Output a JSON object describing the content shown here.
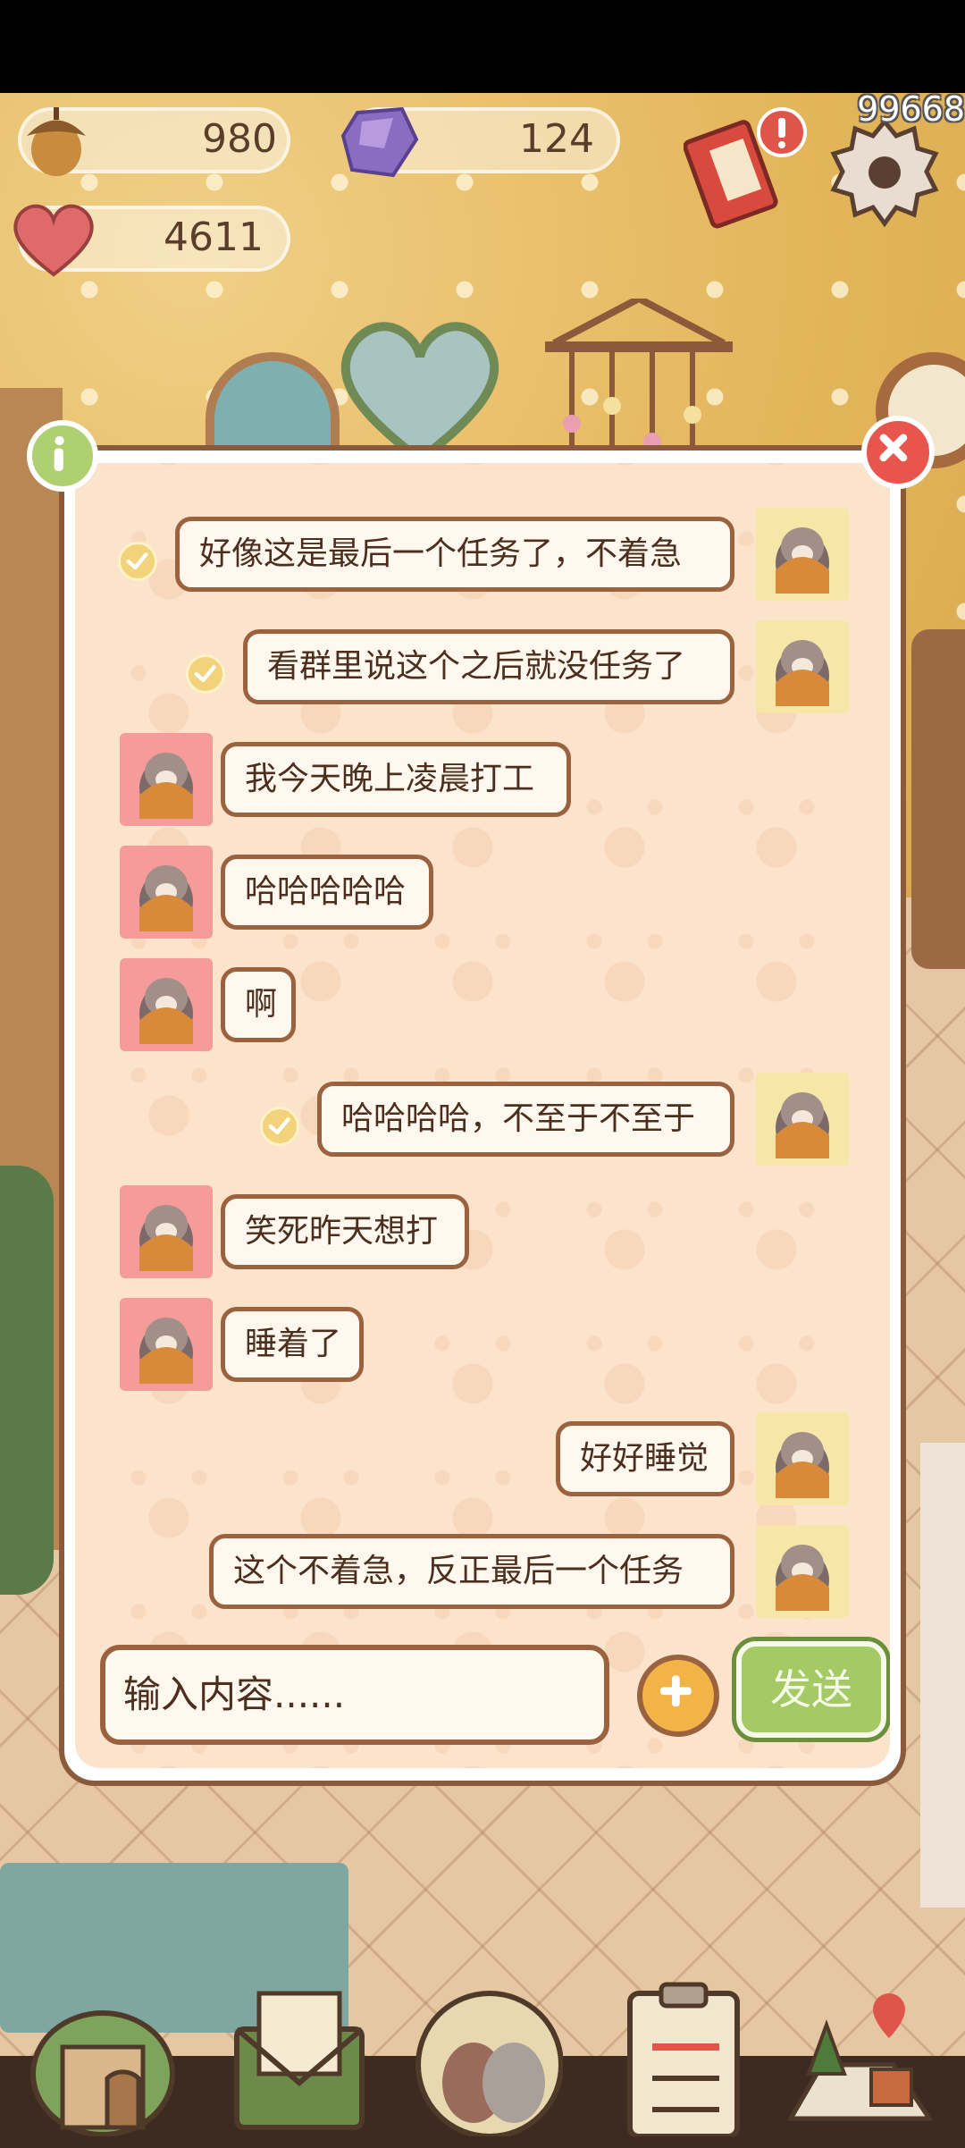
{
  "status_bar": {},
  "hud": {
    "acorns": "980",
    "gems": "124",
    "hearts": "4611",
    "fps_counter": "99668"
  },
  "chat": {
    "messages": [
      {
        "side": "mine",
        "text": "好像这是最后一个任务了，不着急",
        "read": true
      },
      {
        "side": "mine",
        "text": "看群里说这个之后就没任务了",
        "read": true
      },
      {
        "side": "theirs",
        "text": "我今天晚上凌晨打工",
        "read": false
      },
      {
        "side": "theirs",
        "text": "哈哈哈哈哈",
        "read": false
      },
      {
        "side": "theirs",
        "text": "啊",
        "read": false
      },
      {
        "side": "mine",
        "text": "哈哈哈哈，不至于不至于",
        "read": true
      },
      {
        "side": "theirs",
        "text": "笑死昨天想打",
        "read": false
      },
      {
        "side": "theirs",
        "text": "睡着了",
        "read": false
      },
      {
        "side": "mine",
        "text": "好好睡觉",
        "read": false
      },
      {
        "side": "mine",
        "text": "这个不着急，反正最后一个任务",
        "read": false
      }
    ],
    "input_placeholder": "输入内容......",
    "send_label": "发送"
  },
  "colors": {
    "dialog_border": "#8a5a3b",
    "bubble_bg": "#fff8ef",
    "send_button": "#a5c964",
    "close_button": "#e8554c",
    "info_button": "#aed071"
  },
  "icons": [
    "acorn-icon",
    "gem-icon",
    "heart-icon",
    "gift-icon",
    "alert-icon",
    "settings-gear-icon",
    "info-icon",
    "close-icon",
    "plus-icon",
    "check-icon",
    "home-icon",
    "mail-icon",
    "friends-icon",
    "task-list-icon",
    "map-icon"
  ]
}
